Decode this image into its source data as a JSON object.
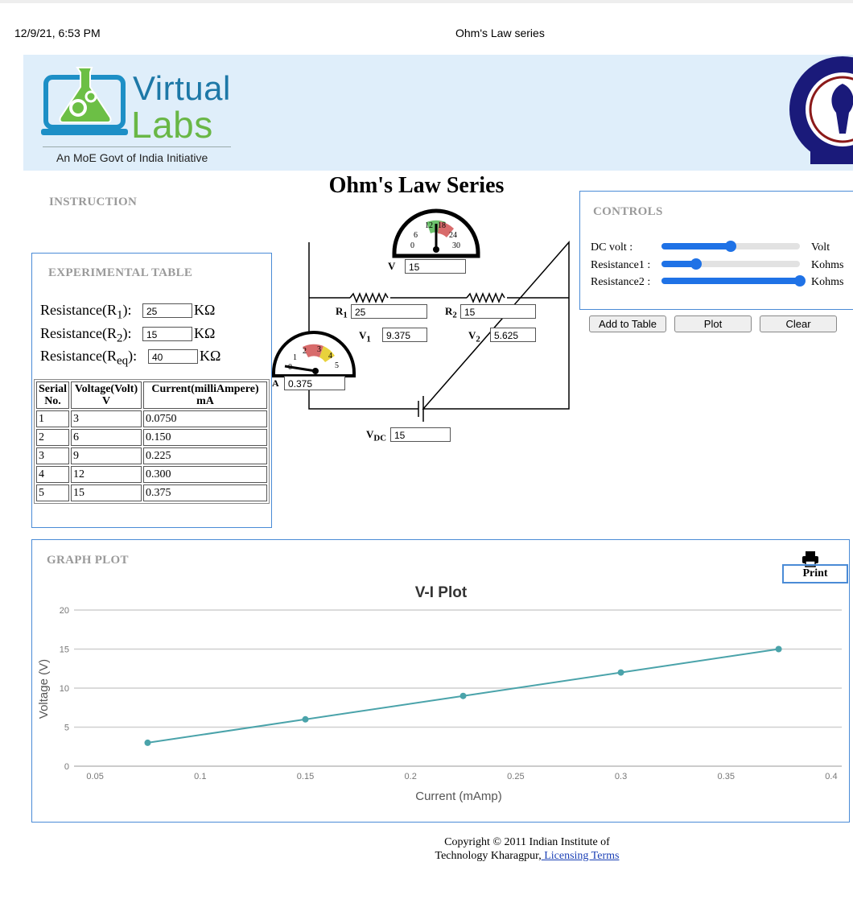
{
  "print_header": {
    "date": "12/9/21, 6:53 PM",
    "title": "Ohm's Law series"
  },
  "brand": {
    "virtual": "Virtual",
    "labs": "Labs",
    "tagline": "An MoE Govt of India Initiative"
  },
  "page_title": "Ohm's Law Series",
  "instruction_label": "INSTRUCTION",
  "experimental_table": {
    "label": "EXPERIMENTAL TABLE",
    "r1": {
      "label": "Resistance(R",
      "sub": "1",
      "close": "):",
      "value": "25",
      "unit": "KΩ"
    },
    "r2": {
      "label": "Resistance(R",
      "sub": "2",
      "close": "):",
      "value": "15",
      "unit": "KΩ"
    },
    "req": {
      "label": "Resistance(R",
      "sub": "eq",
      "close": "):",
      "value": "40",
      "unit": "KΩ"
    },
    "headers": [
      "Serial No.",
      "Voltage(Volt) V",
      "Current(milliAmpere) mA"
    ],
    "rows": [
      [
        "1",
        "3",
        "0.0750"
      ],
      [
        "2",
        "6",
        "0.150"
      ],
      [
        "3",
        "9",
        "0.225"
      ],
      [
        "4",
        "12",
        "0.300"
      ],
      [
        "5",
        "15",
        "0.375"
      ]
    ]
  },
  "circuit": {
    "voltmeter": {
      "label": "V",
      "value": "15",
      "scale": [
        "0",
        "6",
        "12",
        "18",
        "24",
        "30"
      ]
    },
    "ammeter": {
      "label": "A",
      "value": "0.375",
      "scale": [
        "0",
        "1",
        "2",
        "3",
        "4",
        "5"
      ]
    },
    "r1": {
      "label": "R",
      "sub": "1",
      "value": "25"
    },
    "r2": {
      "label": "R",
      "sub": "2",
      "value": "15"
    },
    "v1": {
      "label": "V",
      "sub": "1",
      "value": "9.375"
    },
    "v2": {
      "label": "V",
      "sub": "2",
      "value": "5.625"
    },
    "vdc": {
      "label": "V",
      "sub": "DC",
      "value": "15"
    }
  },
  "controls": {
    "label": "CONTROLS",
    "dc_volt": {
      "label": "DC volt :",
      "unit": "Volt",
      "level": 0.5
    },
    "resistance1": {
      "label": "Resistance1 :",
      "unit": "Kohms",
      "level": 0.25
    },
    "resistance2": {
      "label": "Resistance2 :",
      "unit": "Kohms",
      "level": 1.0
    },
    "buttons": {
      "add": "Add to Table",
      "plot": "Plot",
      "clear": "Clear"
    },
    "accent": "#1f72e6"
  },
  "graph": {
    "label": "GRAPH PLOT",
    "print_label": "Print",
    "print_icon": "printer-icon"
  },
  "chart_data": {
    "type": "line",
    "title": "V-I Plot",
    "xlabel": "Current (mAmp)",
    "ylabel": "Voltage (V)",
    "x": [
      0.075,
      0.15,
      0.225,
      0.3,
      0.375
    ],
    "y": [
      3,
      6,
      9,
      12,
      15
    ],
    "xlim": [
      0.04,
      0.405
    ],
    "ylim": [
      0,
      20
    ],
    "xticks": [
      "0.05",
      "0.1",
      "0.15",
      "0.2",
      "0.25",
      "0.3",
      "0.35",
      "0.4"
    ],
    "yticks": [
      "0",
      "5",
      "10",
      "15",
      "20"
    ],
    "grid": true,
    "color": "#4aa3aa"
  },
  "footer": {
    "line1": "Copyright © 2011 Indian Institute of",
    "line2": "Technology Kharagpur,",
    "link": " Licensing Terms"
  }
}
